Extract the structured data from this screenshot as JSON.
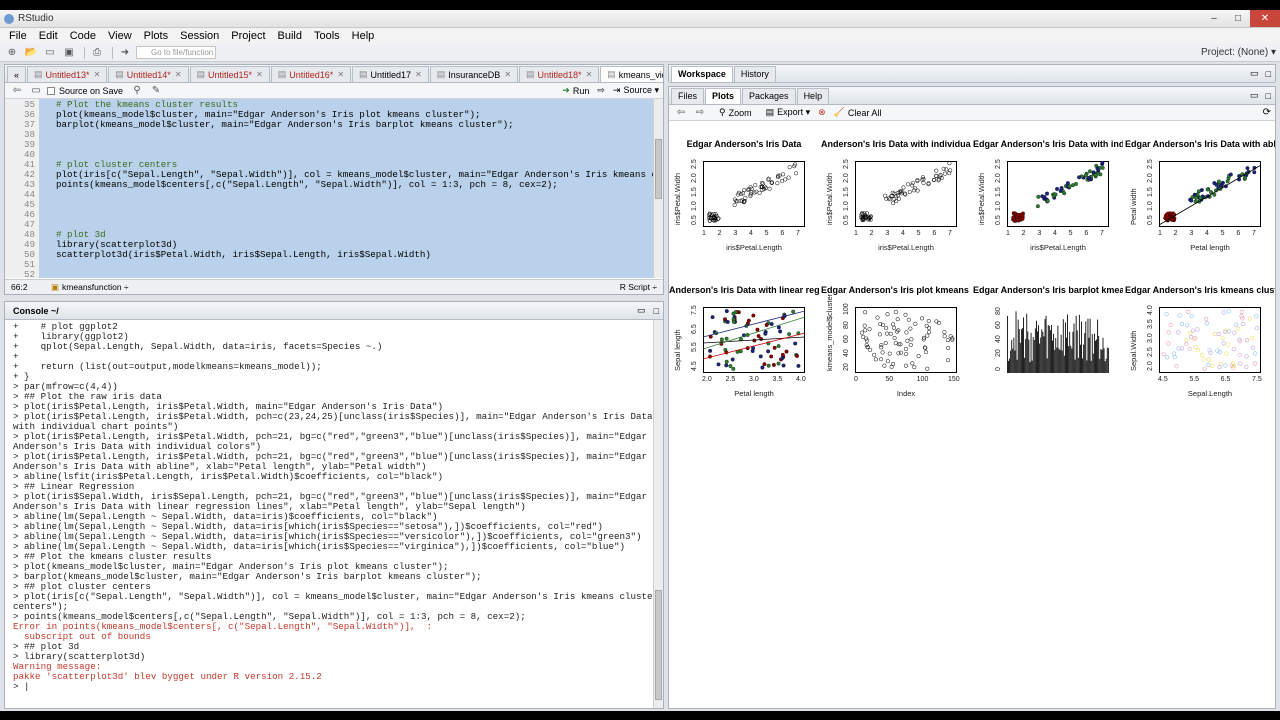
{
  "window": {
    "title": "RStudio",
    "controls": [
      "–",
      "□",
      "✕"
    ]
  },
  "menu": [
    "File",
    "Edit",
    "Code",
    "View",
    "Plots",
    "Session",
    "Project",
    "Build",
    "Tools",
    "Help"
  ],
  "toolbar": {
    "goto_placeholder": "Go to file/function",
    "project": "Project: (None) ▾"
  },
  "editor": {
    "tabs": [
      {
        "label": "Untitled13*",
        "modified": true
      },
      {
        "label": "Untitled14*",
        "modified": true
      },
      {
        "label": "Untitled15*",
        "modified": true
      },
      {
        "label": "Untitled16*",
        "modified": true
      },
      {
        "label": "Untitled17",
        "modified": false
      },
      {
        "label": "InsuranceDB",
        "modified": false
      },
      {
        "label": "Untitled18*",
        "modified": true
      },
      {
        "label": "kmeans_video.R",
        "modified": false,
        "active": true
      }
    ],
    "source_on_save": "Source on Save",
    "run": "Run",
    "source": "Source ▾",
    "line_numbers": [
      "35",
      "36",
      "37",
      "38",
      "39",
      "40",
      "41",
      "42",
      "43",
      "44",
      "45",
      "46",
      "47",
      "48",
      "49",
      "50",
      "51",
      "52"
    ],
    "lines": [
      "  # Plot the kmeans cluster results",
      "  plot(kmeans_model$cluster, main=\"Edgar Anderson's Iris plot kmeans cluster\");",
      "  barplot(kmeans_model$cluster, main=\"Edgar Anderson's Iris barplot kmeans cluster\");",
      "",
      "",
      "",
      "  # plot cluster centers",
      "  plot(iris[c(\"Sepal.Length\", \"Sepal.Width\")], col = kmeans_model$cluster, main=\"Edgar Anderson's Iris kmeans clust",
      "  points(kmeans_model$centers[,c(\"Sepal.Length\", \"Sepal.Width\")], col = 1:3, pch = 8, cex=2);",
      "",
      "",
      "",
      "",
      "  # plot 3d",
      "  library(scatterplot3d)",
      "  scatterplot3d(iris$Petal.Width, iris$Sepal.Length, iris$Sepal.Width)",
      "",
      ""
    ],
    "status_pos": "66:2",
    "status_fn": "kmeansfunction ÷",
    "status_type": "R Script ÷"
  },
  "console": {
    "title": "Console ~/",
    "lines": [
      {
        "t": "+    # plot ggplot2",
        "k": "cont"
      },
      {
        "t": "+    library(ggplot2)",
        "k": "cont"
      },
      {
        "t": "+    qplot(Sepal.Length, Sepal.Width, data=iris, facets=Species ~.)",
        "k": "cont"
      },
      {
        "t": "+",
        "k": "cont"
      },
      {
        "t": "+    return (list(out=output,modelkmeans=kmeans_model));",
        "k": "cont"
      },
      {
        "t": "+ }",
        "k": "cont"
      },
      {
        "t": "> par(mfrow=c(4,4))",
        "k": "prompt"
      },
      {
        "t": "> ## Plot the raw iris data",
        "k": "prompt"
      },
      {
        "t": "> plot(iris$Petal.Length, iris$Petal.Width, main=\"Edgar Anderson's Iris Data\")",
        "k": "prompt"
      },
      {
        "t": "> plot(iris$Petal.Length, iris$Petal.Width, pch=c(23,24,25)[unclass(iris$Species)], main=\"Edgar Anderson's Iris Data",
        "k": "prompt"
      },
      {
        "t": "with individual chart points\")",
        "k": "prompt"
      },
      {
        "t": "> plot(iris$Petal.Length, iris$Petal.Width, pch=21, bg=c(\"red\",\"green3\",\"blue\")[unclass(iris$Species)], main=\"Edgar",
        "k": "prompt"
      },
      {
        "t": "Anderson's Iris Data with individual colors\")",
        "k": "prompt"
      },
      {
        "t": "> plot(iris$Petal.Length, iris$Petal.Width, pch=21, bg=c(\"red\",\"green3\",\"blue\")[unclass(iris$Species)], main=\"Edgar",
        "k": "prompt"
      },
      {
        "t": "Anderson's Iris Data with abline\", xlab=\"Petal length\", ylab=\"Petal width\")",
        "k": "prompt"
      },
      {
        "t": "> abline(lsfit(iris$Petal.Length, iris$Petal.Width)$coefficients, col=\"black\")",
        "k": "prompt"
      },
      {
        "t": "> ## Linear Regression",
        "k": "prompt"
      },
      {
        "t": "> plot(iris$Sepal.Width, iris$Sepal.Length, pch=21, bg=c(\"red\",\"green3\",\"blue\")[unclass(iris$Species)], main=\"Edgar",
        "k": "prompt"
      },
      {
        "t": "Anderson's Iris Data with linear regression lines\", xlab=\"Petal length\", ylab=\"Sepal length\")",
        "k": "prompt"
      },
      {
        "t": "> abline(lm(Sepal.Length ~ Sepal.Width, data=iris)$coefficients, col=\"black\")",
        "k": "prompt"
      },
      {
        "t": "> abline(lm(Sepal.Length ~ Sepal.Width, data=iris[which(iris$Species==\"setosa\"),])$coefficients, col=\"red\")",
        "k": "prompt"
      },
      {
        "t": "> abline(lm(Sepal.Length ~ Sepal.Width, data=iris[which(iris$Species==\"versicolor\"),])$coefficients, col=\"green3\")",
        "k": "prompt"
      },
      {
        "t": "> abline(lm(Sepal.Length ~ Sepal.Width, data=iris[which(iris$Species==\"virginica\"),])$coefficients, col=\"blue\")",
        "k": "prompt"
      },
      {
        "t": "> ## Plot the kmeans cluster results",
        "k": "prompt"
      },
      {
        "t": "> plot(kmeans_model$cluster, main=\"Edgar Anderson's Iris plot kmeans cluster\");",
        "k": "prompt"
      },
      {
        "t": "> barplot(kmeans_model$cluster, main=\"Edgar Anderson's Iris barplot kmeans cluster\");",
        "k": "prompt"
      },
      {
        "t": "> ## plot cluster centers",
        "k": "prompt"
      },
      {
        "t": "> plot(iris[c(\"Sepal.Length\", \"Sepal.Width\")], col = kmeans_model$cluster, main=\"Edgar Anderson's Iris kmeans cluster",
        "k": "prompt"
      },
      {
        "t": "centers\");",
        "k": "prompt"
      },
      {
        "t": "> points(kmeans_model$centers[,c(\"Sepal.Length\", \"Sepal.Width\")], col = 1:3, pch = 8, cex=2);",
        "k": "prompt"
      },
      {
        "t": "Error in points(kmeans_model$centers[, c(\"Sepal.Length\", \"Sepal.Width\")],  :",
        "k": "err"
      },
      {
        "t": "  subscript out of bounds",
        "k": "err"
      },
      {
        "t": "> ## plot 3d",
        "k": "prompt"
      },
      {
        "t": "> library(scatterplot3d)",
        "k": "prompt"
      },
      {
        "t": "Warning message:",
        "k": "err"
      },
      {
        "t": "pakke 'scatterplot3d' blev bygget under R version 2.15.2",
        "k": "err"
      },
      {
        "t": "> |",
        "k": "prompt"
      }
    ]
  },
  "workspace": {
    "tabs": [
      "Workspace",
      "History"
    ]
  },
  "files": {
    "tabs": [
      "Files",
      "Plots",
      "Packages",
      "Help"
    ],
    "zoom": "Zoom",
    "export": "Export ▾",
    "clear": "Clear All"
  },
  "plots": [
    {
      "title": "Edgar Anderson's Iris Data",
      "xlabel": "iris$Petal.Length",
      "ylabel": "iris$Petal.Width",
      "xticks": [
        "1",
        "2",
        "3",
        "4",
        "5",
        "6",
        "7"
      ],
      "yticks": [
        "0.5",
        "1.0",
        "1.5",
        "2.0",
        "2.5"
      ]
    },
    {
      "title": "Anderson's Iris Data with individual ch",
      "xlabel": "iris$Petal.Length",
      "ylabel": "iris$Petal.Width",
      "xticks": [
        "1",
        "2",
        "3",
        "4",
        "5",
        "6",
        "7"
      ],
      "yticks": [
        "0.5",
        "1.0",
        "1.5",
        "2.0",
        "2.5"
      ]
    },
    {
      "title": "Edgar Anderson's Iris Data with individu",
      "xlabel": "iris$Petal.Length",
      "ylabel": "iris$Petal.Width",
      "xticks": [
        "1",
        "2",
        "3",
        "4",
        "5",
        "6",
        "7"
      ],
      "yticks": [
        "0.5",
        "1.0",
        "1.5",
        "2.0",
        "2.5"
      ]
    },
    {
      "title": "Edgar Anderson's Iris Data with abl",
      "xlabel": "Petal length",
      "ylabel": "Petal width",
      "xticks": [
        "1",
        "2",
        "3",
        "4",
        "5",
        "6",
        "7"
      ],
      "yticks": [
        "0.5",
        "1.0",
        "1.5",
        "2.0",
        "2.5"
      ]
    },
    {
      "title": "Anderson's Iris Data with linear regr",
      "xlabel": "Petal length",
      "ylabel": "Sepal length",
      "xticks": [
        "2.0",
        "2.5",
        "3.0",
        "3.5",
        "4.0"
      ],
      "yticks": [
        "4.5",
        "5.5",
        "6.5",
        "7.5"
      ]
    },
    {
      "title": "Edgar Anderson's Iris plot kmeans clu",
      "xlabel": "Index",
      "ylabel": "kmeans_model$cluster",
      "xticks": [
        "0",
        "50",
        "100",
        "150"
      ],
      "yticks": [
        "20",
        "40",
        "60",
        "80",
        "100"
      ]
    },
    {
      "title": "Edgar Anderson's Iris barplot kmeans c",
      "xlabel": "",
      "ylabel": "",
      "xticks": [],
      "yticks": [
        "0",
        "20",
        "40",
        "60",
        "80"
      ]
    },
    {
      "title": "Edgar Anderson's Iris kmeans cluster c",
      "xlabel": "Sepal.Length",
      "ylabel": "Sepal.Width",
      "xticks": [
        "4.5",
        "5.5",
        "6.5",
        "7.5"
      ],
      "yticks": [
        "2.0",
        "2.5",
        "3.0",
        "3.5",
        "4.0"
      ]
    }
  ],
  "colors": {
    "selection": "#b9d1ea",
    "accent": "#2e62a8",
    "error": "#c0392b",
    "red": "#8b0000",
    "green": "#2e7d32",
    "blue": "#1a237e"
  }
}
